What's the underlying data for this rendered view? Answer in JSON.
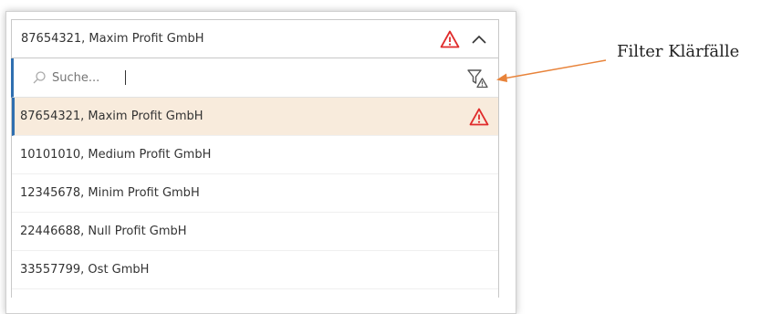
{
  "select": {
    "value": "87654321, Maxim Profit GmbH"
  },
  "search": {
    "placeholder": "Suche..."
  },
  "options": [
    {
      "label": "87654321, Maxim Profit GmbH",
      "warning": true,
      "selected": true
    },
    {
      "label": "10101010, Medium Profit GmbH",
      "warning": false,
      "selected": false
    },
    {
      "label": "12345678, Minim Profit GmbH",
      "warning": false,
      "selected": false
    },
    {
      "label": "22446688, Null Profit GmbH",
      "warning": false,
      "selected": false
    },
    {
      "label": "33557799, Ost GmbH",
      "warning": false,
      "selected": false
    }
  ],
  "callout": {
    "text": "Filter Klärfälle"
  },
  "colors": {
    "warning": "#e02b2b",
    "arrow": "#e8833a",
    "selected_bg": "#f8ebdc",
    "accent": "#2f6fb0"
  },
  "icons": {
    "warning": "warning-triangle-icon",
    "collapse": "chevron-up-icon",
    "search": "search-icon",
    "filter": "filter-warning-icon"
  }
}
